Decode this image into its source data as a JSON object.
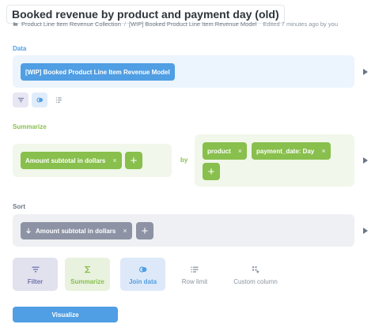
{
  "header": {
    "title": "Booked revenue by product and payment day (old)",
    "breadcrumb": {
      "collection": "Product Line Item Revenue Collection",
      "separator": "/",
      "model": "[WIP] Booked Product Line Item Revenue Model"
    },
    "edited": "Edited 7 minutes ago by you"
  },
  "data_step": {
    "label": "Data",
    "source": "[WIP] Booked Product Line Item Revenue Model",
    "mini_actions": [
      "filter-icon",
      "join-icon",
      "row-limit-icon"
    ]
  },
  "summarize_step": {
    "label": "Summarize",
    "metrics": [
      {
        "label": "Amount subtotal in dollars",
        "remove": "×"
      }
    ],
    "by": "by",
    "breakouts": [
      {
        "label": "product",
        "remove": "×"
      },
      {
        "label": "payment_date: Day",
        "remove": "×"
      }
    ],
    "add": "+"
  },
  "sort_step": {
    "label": "Sort",
    "sorts": [
      {
        "label": "Amount subtotal in dollars",
        "direction": "descending",
        "remove": "×"
      }
    ],
    "add": "+"
  },
  "actions": {
    "filter": "Filter",
    "summarize": "Summarize",
    "join": "Join data",
    "row_limit": "Row limit",
    "custom_column": "Custom column"
  },
  "visualize": "Visualize",
  "colors": {
    "data": "#509ee3",
    "summarize": "#88bf4d",
    "sort": "#8d93a5",
    "filter": "#7173ad"
  }
}
